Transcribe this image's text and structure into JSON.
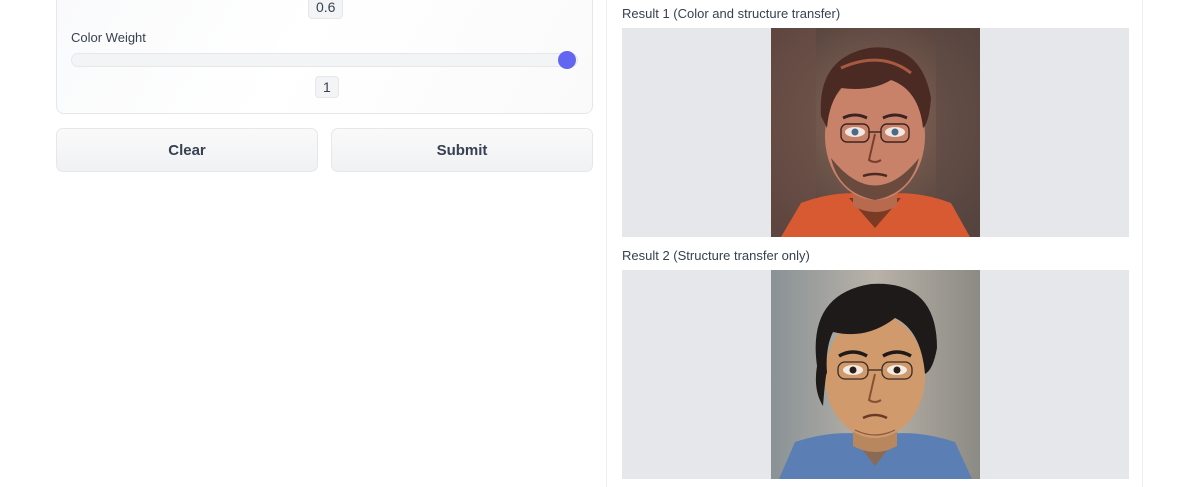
{
  "controls": {
    "prev_slider_value": "0.6",
    "color_weight": {
      "label": "Color Weight",
      "value": "1",
      "fraction": 1.0
    }
  },
  "actions": {
    "clear_label": "Clear",
    "submit_label": "Submit"
  },
  "results": [
    {
      "label": "Result 1 (Color and structure transfer)"
    },
    {
      "label": "Result 2 (Structure transfer only)"
    }
  ],
  "colors": {
    "accent": "#6366f1",
    "image_background": "#e5e7eb"
  }
}
